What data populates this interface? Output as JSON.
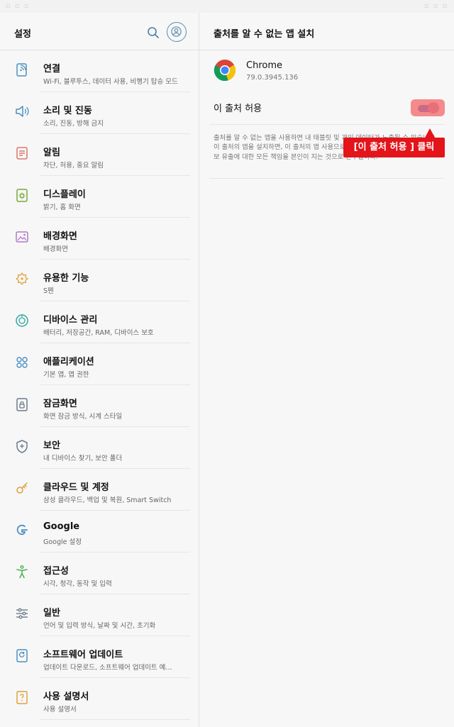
{
  "status_bar": {
    "left": "▫ ▫ ▫",
    "right": "▫ ▫ ▫"
  },
  "left_panel": {
    "title": "설정",
    "items": [
      {
        "title": "연결",
        "subtitle": "Wi-Fi, 블루투스, 데이터 사용, 비행기 탑승 모드",
        "icon": "connection-icon",
        "color": "#4a90c2"
      },
      {
        "title": "소리 및 진동",
        "subtitle": "소리, 진동, 방해 금지",
        "icon": "sound-icon",
        "color": "#4a90c2"
      },
      {
        "title": "알림",
        "subtitle": "차단, 허용, 중요 알림",
        "icon": "notification-icon",
        "color": "#e0746b"
      },
      {
        "title": "디스플레이",
        "subtitle": "밝기, 홈 화면",
        "icon": "display-icon",
        "color": "#79a838"
      },
      {
        "title": "배경화면",
        "subtitle": "배경화면",
        "icon": "wallpaper-icon",
        "color": "#b07cc9"
      },
      {
        "title": "유용한 기능",
        "subtitle": "S펜",
        "icon": "advanced-features-icon",
        "color": "#e0a23a"
      },
      {
        "title": "디바이스 관리",
        "subtitle": "배터리, 저장공간, RAM, 디바이스 보호",
        "icon": "device-care-icon",
        "color": "#33a7a0"
      },
      {
        "title": "애플리케이션",
        "subtitle": "기본 앱, 앱 권한",
        "icon": "apps-icon",
        "color": "#4a90c2"
      },
      {
        "title": "잠금화면",
        "subtitle": "화면 잠금 방식, 시계 스타일",
        "icon": "lock-screen-icon",
        "color": "#6b7a8a"
      },
      {
        "title": "보안",
        "subtitle": "내 디바이스 찾기, 보안 폴더",
        "icon": "security-icon",
        "color": "#6b7a8a"
      },
      {
        "title": "클라우드 및 계정",
        "subtitle": "삼성 클라우드, 백업 및 복원, Smart Switch",
        "icon": "key-icon",
        "color": "#e0a23a"
      },
      {
        "title": "Google",
        "subtitle": "Google 설정",
        "icon": "google-icon",
        "color": "#4a90c2"
      },
      {
        "title": "접근성",
        "subtitle": "시각, 청각, 동작 및 입력",
        "icon": "accessibility-icon",
        "color": "#4caf50"
      },
      {
        "title": "일반",
        "subtitle": "언어 및 입력 방식, 날짜 및 시간, 초기화",
        "icon": "sliders-icon",
        "color": "#6b7a8a"
      },
      {
        "title": "소프트웨어 업데이트",
        "subtitle": "업데이트 다운로드, 소프트웨어 업데이트 예...",
        "icon": "software-update-icon",
        "color": "#4a90c2"
      },
      {
        "title": "사용 설명서",
        "subtitle": "사용 설명서",
        "icon": "user-manual-icon",
        "color": "#e0a23a"
      }
    ]
  },
  "right_panel": {
    "title": "출처를 알 수 없는 앱 설치",
    "app": {
      "name": "Chrome",
      "version": "79.0.3945.136",
      "icon": "chrome-icon"
    },
    "allow_label": "이 출처 허용",
    "toggle_on": true,
    "description": "출처를 알 수 없는 앱을 사용하면 내 태블릿 및 개인 데이터가 노출될 수 있습니다. 이 출처의 앱을 설치하면, 이 출처의 앱 사용으로 발생할 수 있는 태블릿 손상 및 정보 유출에 대한 모든 책임을 본인이 지는 것으로 간주됩니다."
  },
  "callout": {
    "text": "[이 출처 허용 ] 클릭",
    "color": "#e3141a"
  }
}
